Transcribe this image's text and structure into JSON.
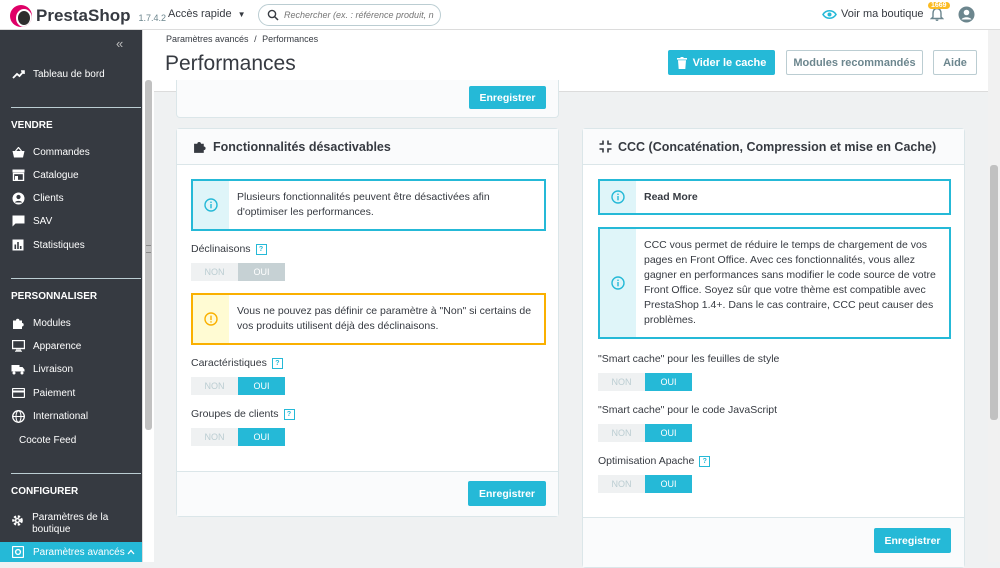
{
  "header": {
    "brand": "PrestaShop",
    "version": "1.7.4.2",
    "quick_access": "Accès rapide",
    "search_placeholder": "Rechercher (ex. : référence produit, nom",
    "view_shop": "Voir ma boutique",
    "notifications_count": "1669"
  },
  "sidebar": {
    "collapse": "«",
    "dashboard": "Tableau de bord",
    "section_sell": "VENDRE",
    "sell_items": [
      "Commandes",
      "Catalogue",
      "Clients",
      "SAV",
      "Statistiques"
    ],
    "section_customize": "PERSONNALISER",
    "customize_items": [
      "Modules",
      "Apparence",
      "Livraison",
      "Paiement",
      "International",
      "Cocote Feed"
    ],
    "section_configure": "CONFIGURER",
    "configure_items": [
      "Paramètres de la boutique",
      "Paramètres avancés"
    ]
  },
  "page": {
    "breadcrumb_parent": "Paramètres avancés",
    "breadcrumb_sep": "/",
    "breadcrumb_current": "Performances",
    "title": "Performances",
    "clear_cache": "Vider le cache",
    "recommended_modules": "Modules recommandés",
    "help": "Aide"
  },
  "top_panel": {
    "save": "Enregistrer"
  },
  "features_panel": {
    "title": "Fonctionnalités désactivables",
    "info": "Plusieurs fonctionnalités peuvent être désactivées afin d'optimiser les performances.",
    "combinations_label": "Déclinaisons",
    "warning": "Vous ne pouvez pas définir ce paramètre à \"Non\" si certains de vos produits utilisent déjà des déclinaisons.",
    "features_label": "Caractéristiques",
    "groups_label": "Groupes de clients",
    "no": "NON",
    "yes": "OUI",
    "help_mark": "?",
    "save": "Enregistrer"
  },
  "ccc_panel": {
    "title": "CCC (Concaténation, Compression et mise en Cache)",
    "read_more": "Read More",
    "info": "CCC vous permet de réduire le temps de chargement de vos pages en Front Office. Avec ces fonctionnalités, vous allez gagner en performances sans modifier le code source de votre Front Office. Soyez sûr que votre thème est compatible avec PrestaShop 1.4+. Dans le cas contraire, CCC peut causer des problèmes.",
    "css_label": "\"Smart cache\" pour les feuilles de style",
    "js_label": "\"Smart cache\" pour le code JavaScript",
    "apache_label": "Optimisation Apache",
    "no": "NON",
    "yes": "OUI",
    "help_mark": "?",
    "save": "Enregistrer"
  },
  "colors": {
    "primary": "#25b9d7",
    "sidebar_bg": "#363a41",
    "warning": "#fab000",
    "brand": "#df0067"
  }
}
